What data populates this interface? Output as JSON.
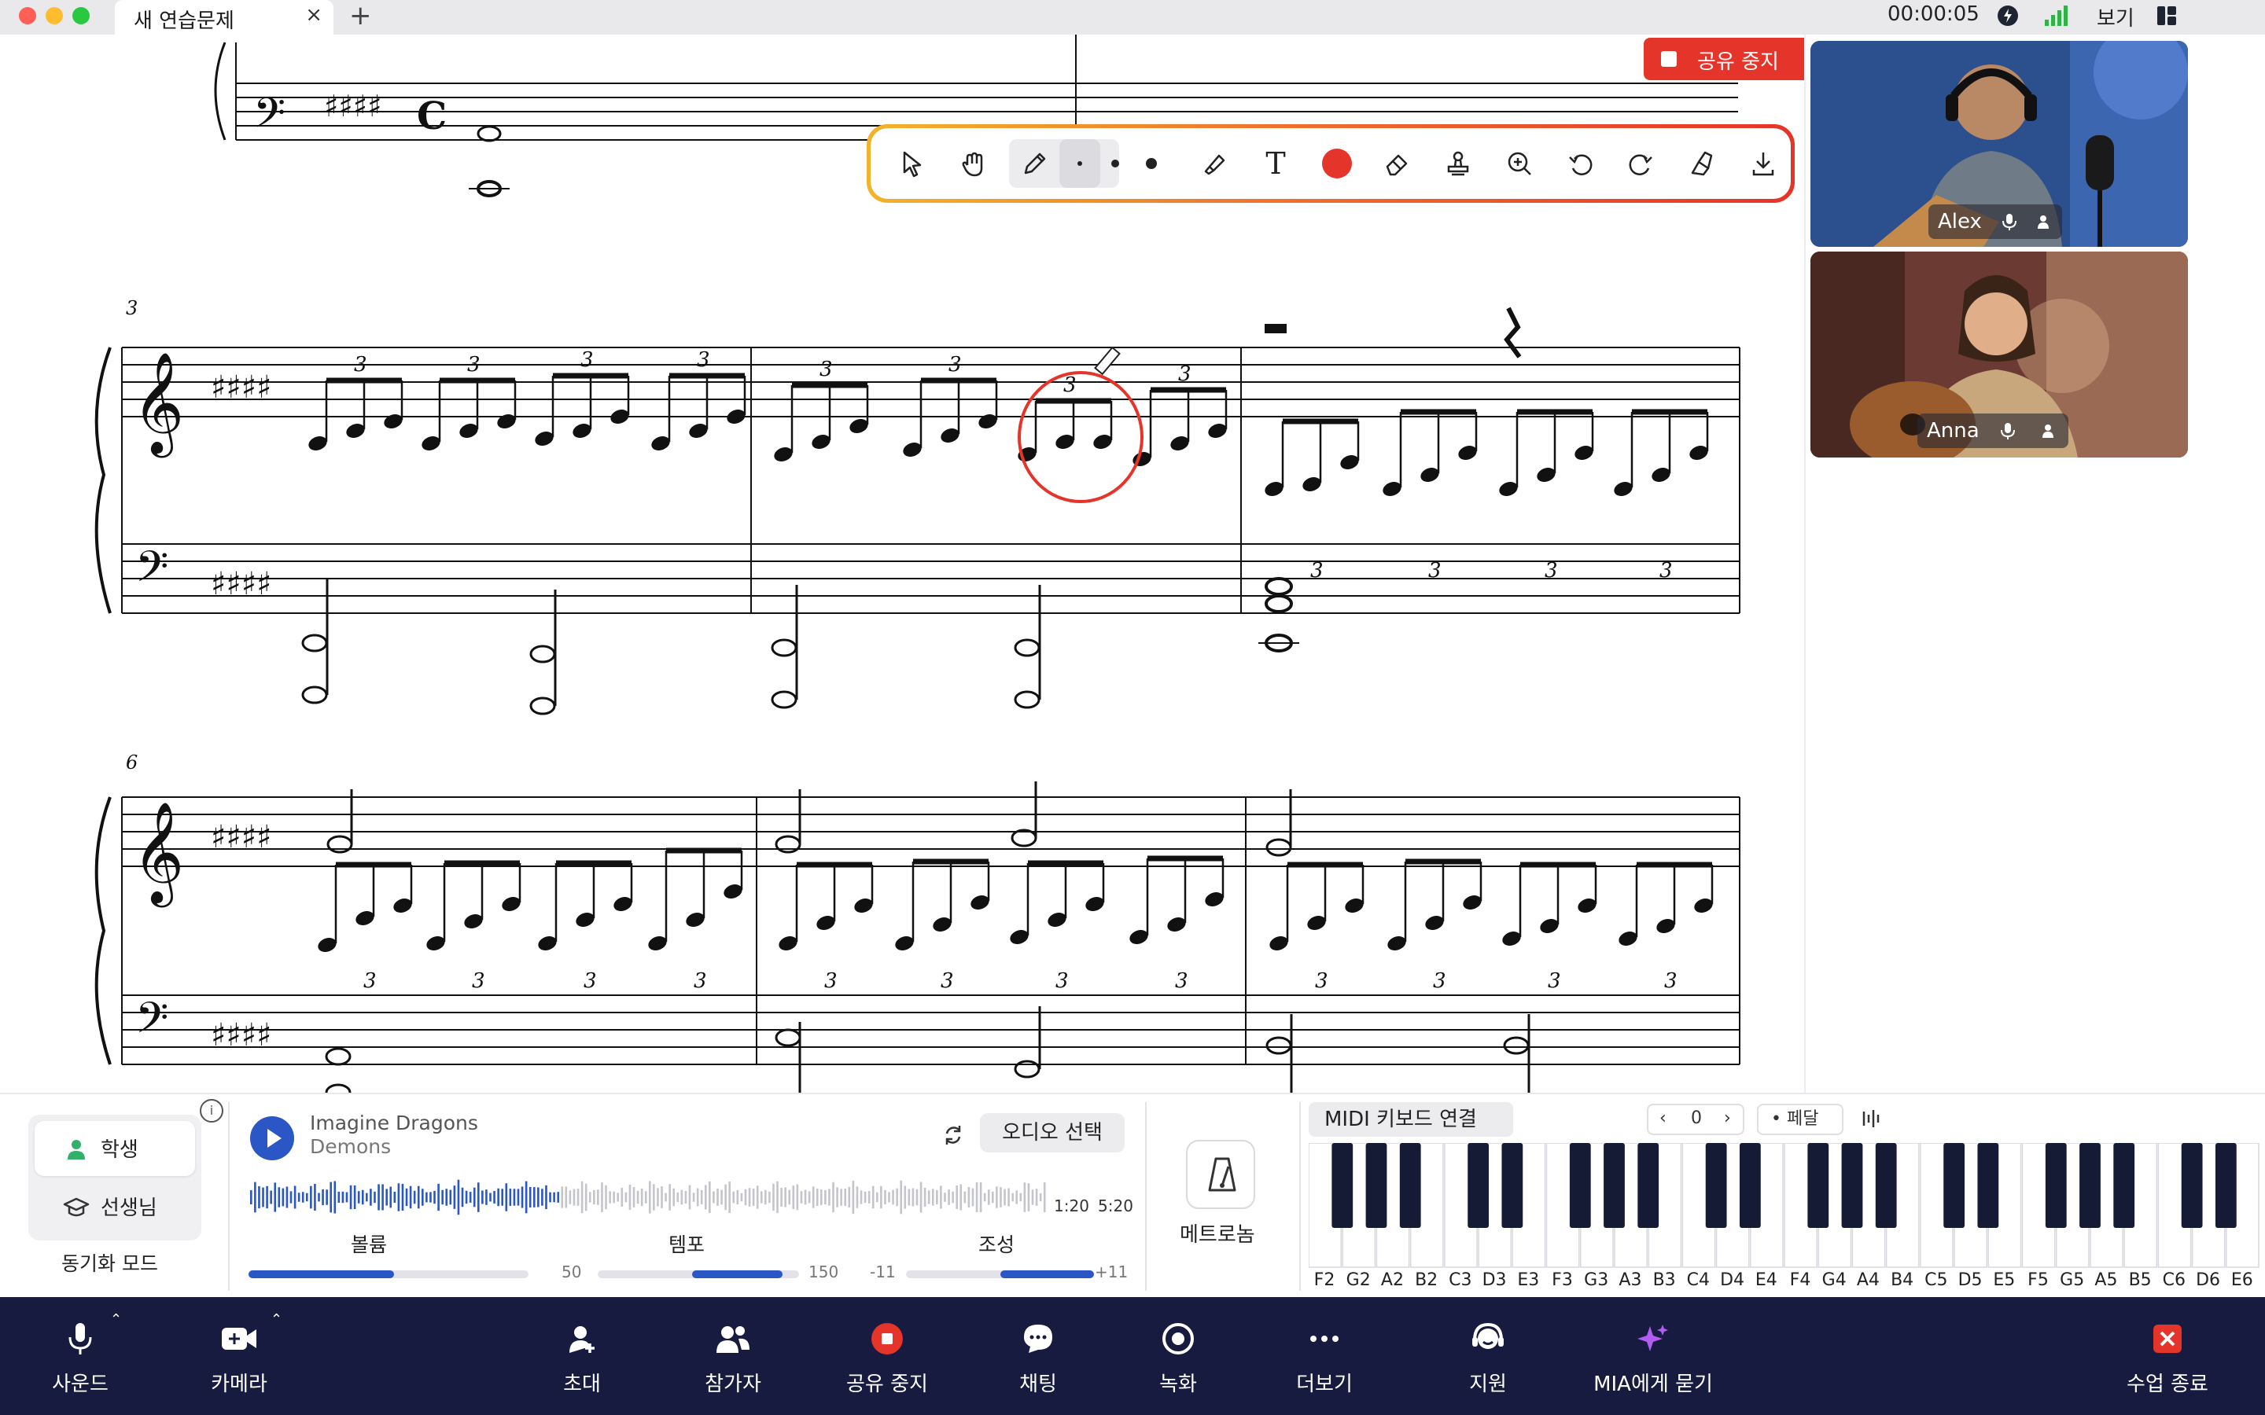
{
  "window": {
    "tab_title": "새 연습문제",
    "tab_close": "×",
    "tab_add": "+",
    "timer": "00:00:05",
    "view_label": "보기"
  },
  "share_banner": {
    "label": "공유 중지",
    "color": "#e5342a"
  },
  "annotation_toolbar": {
    "tools": [
      "select-arrow-icon",
      "hand-icon",
      "pencil-icon",
      "small-dot-icon",
      "medium-dot-icon",
      "large-dot-icon",
      "highlighter-icon",
      "text-icon",
      "color-swatch",
      "eraser-icon",
      "stamp-icon",
      "zoom-in-icon",
      "undo-icon",
      "redo-icon",
      "clear-icon",
      "download-icon"
    ],
    "active_tool": "pencil-icon",
    "active_size": "small-dot-icon",
    "ink_color": "#e5342a",
    "text_glyph": "T"
  },
  "score": {
    "measure_numbers": [
      "3",
      "6"
    ],
    "triplet_mark": "3",
    "key_signature": "E major (4 sharps)",
    "time_signature": "C"
  },
  "participants": [
    {
      "name": "Alex"
    },
    {
      "name": "Anna"
    }
  ],
  "mode_panel": {
    "student": "학생",
    "teacher": "선생님",
    "sync_mode": "동기화 모드",
    "info": "i"
  },
  "player": {
    "artist": "Imagine Dragons",
    "title": "Demons",
    "audio_select": "오디오 선택",
    "current_time": "1:20",
    "total_time": "5:20",
    "progress": 0.392
  },
  "sliders": {
    "volume": {
      "label": "볼륨",
      "value": 50,
      "max_label": "50",
      "fraction": 0.52
    },
    "tempo": {
      "label": "템포",
      "value": 150,
      "max_label": "150",
      "fraction": 0.45
    },
    "key": {
      "label": "조성",
      "min_label": "-11",
      "max_label": "+11",
      "fraction": 0.52
    }
  },
  "metronome": {
    "label": "메트로놈"
  },
  "midi": {
    "label": "MIDI 키보드 연결",
    "octave_prev": "‹",
    "octave_value": "0",
    "octave_next": "›",
    "pedal": "• 페달",
    "note_names": [
      "F2",
      "G2",
      "A2",
      "B2",
      "C3",
      "D3",
      "E3",
      "F3",
      "G3",
      "A3",
      "B3",
      "C4",
      "D4",
      "E4",
      "F4",
      "G4",
      "A4",
      "B4",
      "C5",
      "D5",
      "E5",
      "F5",
      "G5",
      "A5",
      "B5",
      "C6",
      "D6",
      "E6"
    ]
  },
  "dock": {
    "sound": "사운드",
    "camera": "카메라",
    "invite": "초대",
    "participants": "참가자",
    "stop_share": "공유 중지",
    "chat": "채팅",
    "record": "녹화",
    "more": "더보기",
    "support": "지원",
    "ask_mia": "MIA에게 묻기",
    "end_class": "수업 종료"
  },
  "colors": {
    "dock_bg": "#161b3f",
    "accent_blue": "#2a56c6",
    "danger_red": "#e5342a",
    "mia_purple": "#b35cf2"
  }
}
